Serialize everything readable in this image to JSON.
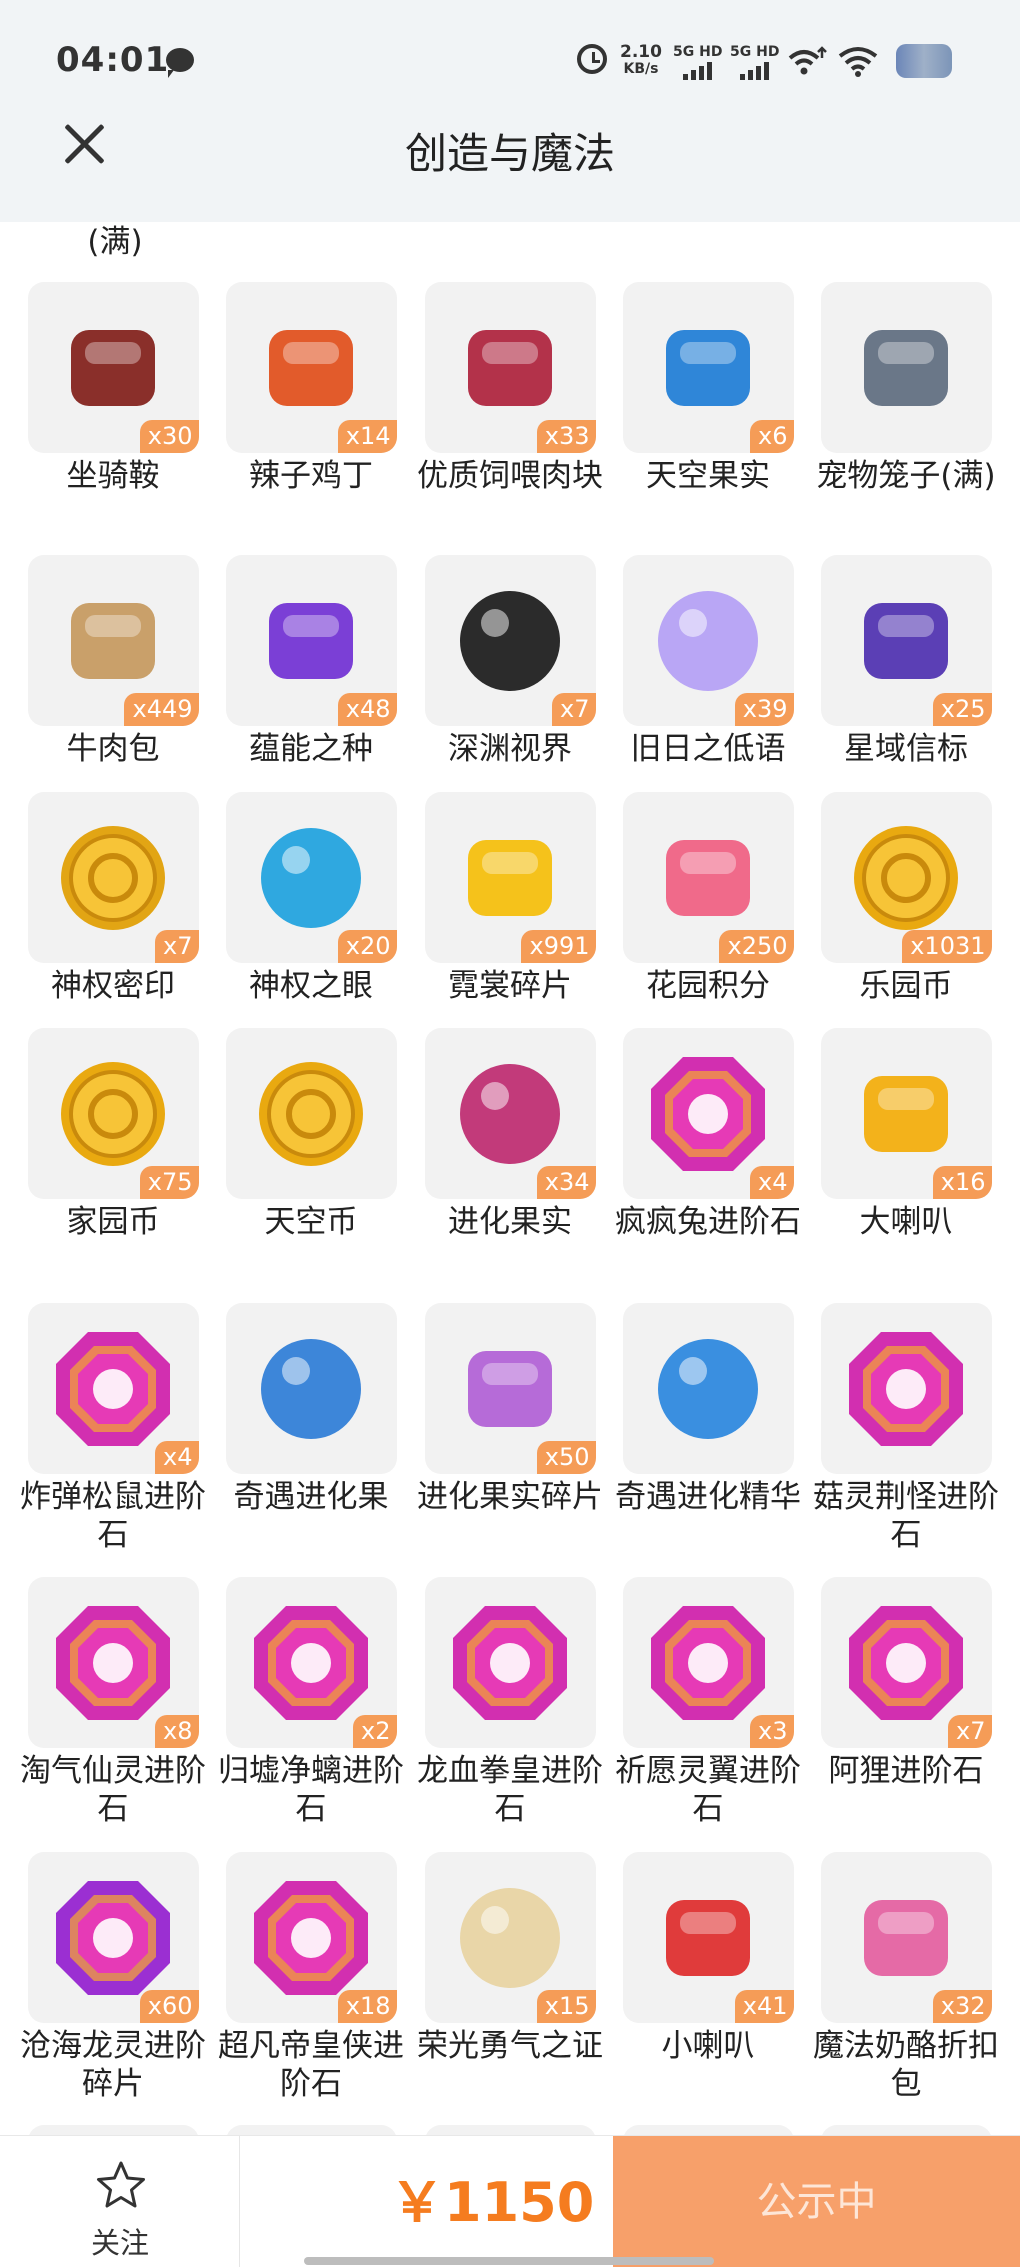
{
  "status_bar": {
    "time": "04:01",
    "speed_value": "2.10",
    "speed_unit": "KB/s",
    "sim1": "5G HD",
    "sim2": "5G HD"
  },
  "header": {
    "title": "创造与魔法"
  },
  "partial_label": "(满)",
  "items": [
    {
      "name": "坐骑鞍",
      "qty": "x30",
      "icon": "saddle-icon",
      "color": "#8a2f2a"
    },
    {
      "name": "辣子鸡丁",
      "qty": "x14",
      "icon": "spicy-chicken-icon",
      "color": "#e25b2b"
    },
    {
      "name": "优质饲喂肉块",
      "qty": "x33",
      "icon": "meat-icon",
      "color": "#b3324a"
    },
    {
      "name": "天空果实",
      "qty": "x6",
      "icon": "sky-fruit-plant-icon",
      "color": "#2f86d8"
    },
    {
      "name": "宠物笼子(满)",
      "qty": "",
      "icon": "pet-cage-icon",
      "color": "#6a7788"
    },
    {
      "name": "牛肉包",
      "qty": "x449",
      "icon": "bun-basket-icon",
      "color": "#c9a06a"
    },
    {
      "name": "蕴能之种",
      "qty": "x48",
      "icon": "purple-crystal-icon",
      "color": "#7b3fd6"
    },
    {
      "name": "深渊视界",
      "qty": "x7",
      "icon": "abyss-eye-icon",
      "color": "#2b2b2b"
    },
    {
      "name": "旧日之低语",
      "qty": "x39",
      "icon": "glowing-orb-icon",
      "color": "#b9a6f5"
    },
    {
      "name": "星域信标",
      "qty": "x25",
      "icon": "star-beacon-icon",
      "color": "#5b3fb5"
    },
    {
      "name": "神权密印",
      "qty": "x7",
      "icon": "gold-seal-coin-icon",
      "color": "#e2a514"
    },
    {
      "name": "神权之眼",
      "qty": "x20",
      "icon": "winged-eye-icon",
      "color": "#2fa8e0"
    },
    {
      "name": "霓裳碎片",
      "qty": "x991",
      "icon": "yellow-shirt-icon",
      "color": "#f5c21b"
    },
    {
      "name": "花园积分",
      "qty": "x250",
      "icon": "flower-badge-icon",
      "color": "#f06a8a"
    },
    {
      "name": "乐园币",
      "qty": "x1031",
      "icon": "paradise-coin-icon",
      "color": "#e9a910"
    },
    {
      "name": "家园币",
      "qty": "x75",
      "icon": "home-coin-icon",
      "color": "#e9a910"
    },
    {
      "name": "天空币",
      "qty": "",
      "icon": "sky-coin-icon",
      "color": "#e9a910"
    },
    {
      "name": "进化果实",
      "qty": "x34",
      "icon": "evolution-berry-icon",
      "color": "#c23a7a"
    },
    {
      "name": "疯疯兔进阶石",
      "qty": "x4",
      "icon": "rabbit-gem-icon",
      "color": "#d22fb0"
    },
    {
      "name": "大喇叭",
      "qty": "x16",
      "icon": "big-megaphone-icon",
      "color": "#f3b21b"
    },
    {
      "name": "炸弹松鼠进阶石",
      "qty": "x4",
      "icon": "squirrel-gem-icon",
      "color": "#d22fb0"
    },
    {
      "name": "奇遇进化果",
      "qty": "",
      "icon": "blue-berry-icon",
      "color": "#3d86d9"
    },
    {
      "name": "进化果实碎片",
      "qty": "x50",
      "icon": "fruit-slice-icon",
      "color": "#b66bd8"
    },
    {
      "name": "奇遇进化精华",
      "qty": "",
      "icon": "blue-essence-icon",
      "color": "#3a8fe0"
    },
    {
      "name": "菇灵荆怪进阶石",
      "qty": "",
      "icon": "mushroom-gem-icon",
      "color": "#d22fb0"
    },
    {
      "name": "淘气仙灵进阶石",
      "qty": "x8",
      "icon": "fairy-gem-icon",
      "color": "#d22fb0"
    },
    {
      "name": "归墟净螭进阶石",
      "qty": "x2",
      "icon": "dragon-gem-icon",
      "color": "#d22fb0"
    },
    {
      "name": "龙血拳皇进阶石",
      "qty": "",
      "icon": "bull-gem-icon",
      "color": "#d22fb0"
    },
    {
      "name": "祈愿灵翼进阶石",
      "qty": "x3",
      "icon": "wing-gem-icon",
      "color": "#d22fb0"
    },
    {
      "name": "阿狸进阶石",
      "qty": "x7",
      "icon": "fox-gem-icon",
      "color": "#d22fb0"
    },
    {
      "name": "沧海龙灵进阶碎片",
      "qty": "x60",
      "icon": "sea-dragon-shard-icon",
      "color": "#9b2fd2"
    },
    {
      "name": "超凡帝皇侠进阶石",
      "qty": "x18",
      "icon": "emperor-gem-icon",
      "color": "#d22fb0"
    },
    {
      "name": "荣光勇气之证",
      "qty": "x15",
      "icon": "glory-medal-icon",
      "color": "#e9d6a8"
    },
    {
      "name": "小喇叭",
      "qty": "x41",
      "icon": "small-megaphone-icon",
      "color": "#e03b3b"
    },
    {
      "name": "魔法奶酪折扣包",
      "qty": "x32",
      "icon": "gift-box-icon",
      "color": "#e56aa6"
    }
  ],
  "bottom_bar": {
    "follow_label": "关注",
    "price": "￥1150",
    "status_button": "公示中"
  }
}
